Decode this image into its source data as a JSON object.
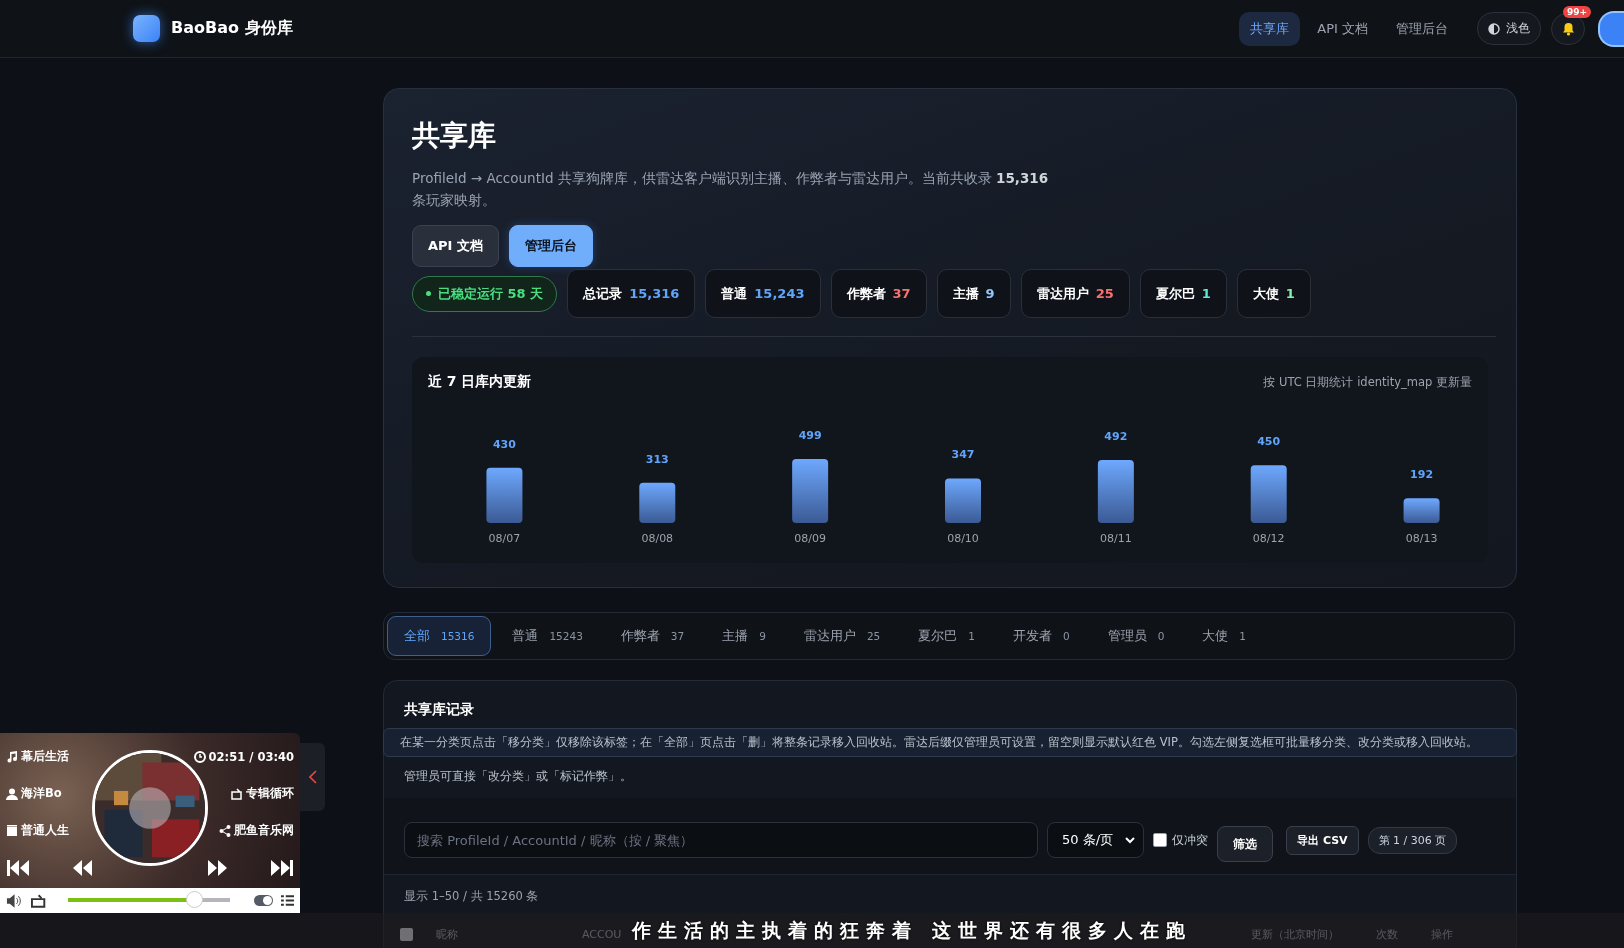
{
  "header": {
    "brand": "BaoBao 身份库",
    "nav": [
      {
        "label": "共享库",
        "selected": true
      },
      {
        "label": "API 文档",
        "selected": false
      },
      {
        "label": "管理后台",
        "selected": false
      }
    ],
    "theme_button": "浅色",
    "notification_badge": "99+"
  },
  "hero": {
    "title": "共享库",
    "description": "ProfileId → AccountId 共享狗牌库，供雷达客户端识别主播、作弊者与雷达用户。当前共收录 **15,316** 条玩家映射。",
    "buttons": [
      {
        "label": "API 文档",
        "kind": "secondary"
      },
      {
        "label": "管理后台",
        "kind": "primary"
      }
    ],
    "uptime": "已稳定运行 58 天",
    "stats": [
      {
        "label": "总记录",
        "value": "15,316",
        "color": "#60a5fa"
      },
      {
        "label": "普通",
        "value": "15,243",
        "color": "#60a5fa"
      },
      {
        "label": "作弊者",
        "value": "37",
        "color": "#f87171"
      },
      {
        "label": "主播",
        "value": "9",
        "color": "#93c5fd"
      },
      {
        "label": "雷达用户",
        "value": "25",
        "color": "#f87171"
      },
      {
        "label": "夏尔巴",
        "value": "1",
        "color": "#5eead4"
      },
      {
        "label": "大使",
        "value": "1",
        "color": "#86efac"
      }
    ]
  },
  "chart": {
    "title": "近 7 日库内更新",
    "note": "按 UTC 日期统计 identity_map 更新量",
    "chart_data": {
      "type": "bar",
      "categories": [
        "08/07",
        "08/08",
        "08/09",
        "08/10",
        "08/11",
        "08/12",
        "08/13"
      ],
      "values": [
        430,
        313,
        499,
        347,
        492,
        450,
        192
      ],
      "data_labels": true
    }
  },
  "filter_tabs": [
    {
      "label": "全部",
      "count": "15316",
      "selected": true
    },
    {
      "label": "普通",
      "count": "15243",
      "selected": false
    },
    {
      "label": "作弊者",
      "count": "37",
      "selected": false
    },
    {
      "label": "主播",
      "count": "9",
      "selected": false
    },
    {
      "label": "雷达用户",
      "count": "25",
      "selected": false
    },
    {
      "label": "夏尔巴",
      "count": "1",
      "selected": false
    },
    {
      "label": "开发者",
      "count": "0",
      "selected": false
    },
    {
      "label": "管理员",
      "count": "0",
      "selected": false
    },
    {
      "label": "大使",
      "count": "1",
      "selected": false
    }
  ],
  "records": {
    "title": "共享库记录",
    "notice": "在某一分类页点击「移分类」仅移除该标签；在「全部」页点击「删」将整条记录移入回收站。雷达后缀仅管理员可设置，留空则显示默认红色 VIP。勾选左侧复选框可批量移分类、改分类或移入回收站。",
    "admin_note": "管理员可直接「改分类」或「标记作弊」。",
    "search": {
      "placeholder": "搜索 ProfileId / AccountId / 昵称（按 / 聚焦）"
    },
    "page_size": "50 条/页",
    "conflict_only": {
      "label": "仅冲突",
      "checked": false
    },
    "filter_button": "筛选",
    "export_button": "导出 CSV",
    "page_indicator": "第 1 / 306 页",
    "summary": "显示 1–50 / 共 15260 条",
    "table": {
      "select_all_checked": false,
      "columns": [
        "昵称",
        "ACCOU",
        "更新（北京时间）",
        "次数",
        "操作"
      ]
    }
  },
  "player": {
    "song": "幕后生活",
    "time": "02:51 / 03:40",
    "artist": "海洋Bo",
    "loop_mode": "专辑循环",
    "album": "普通人生",
    "source": "肥鱼音乐网",
    "progress": {
      "level": 0.78
    },
    "toggle_on": true
  },
  "lyrics": "作生活的主执着的狂奔着 这世界还有很多人在跑"
}
